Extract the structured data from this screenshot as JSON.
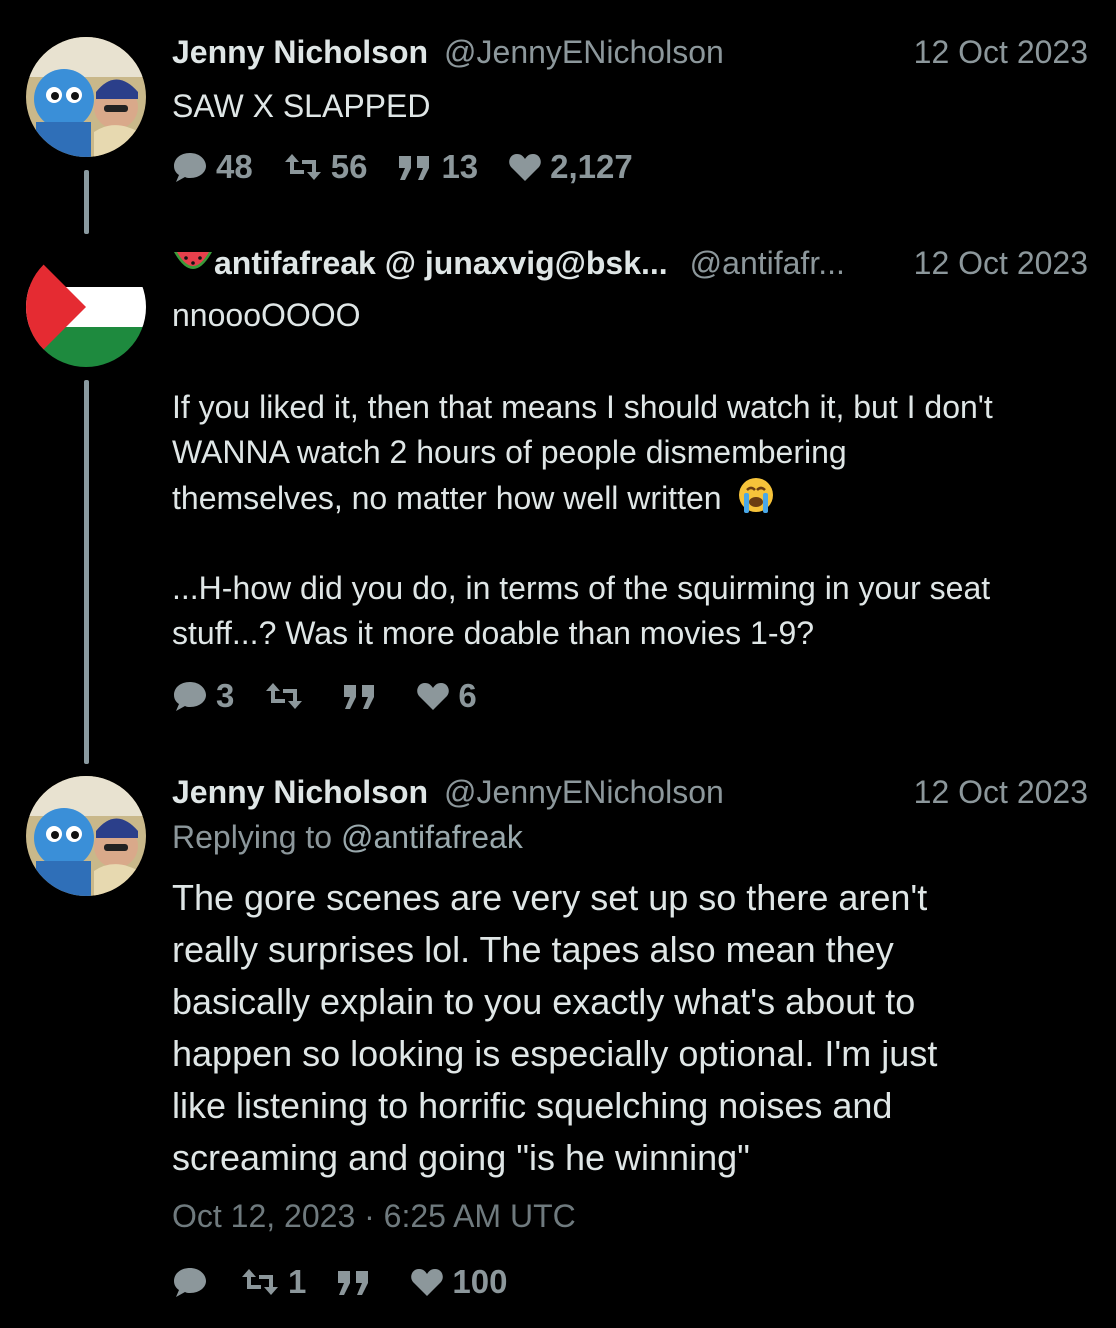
{
  "tweets": [
    {
      "name": "Jenny Nicholson",
      "handle": "@JennyENicholson",
      "date": "12 Oct 2023",
      "text": [
        "SAW X SLAPPED"
      ],
      "stats": {
        "replies": "48",
        "retweets": "56",
        "quotes": "13",
        "likes": "2,127"
      }
    },
    {
      "name": "antifafreak @ junaxvig@bsk...",
      "handle": "@antifafr...",
      "date": "12 Oct 2023",
      "text": [
        "nnoooOOOO",
        "",
        "If you liked it, then that means I should watch it, but I don't",
        "WANNA watch 2 hours of people dismembering",
        "themselves, no matter how well written",
        "",
        "...H-how did you do, in terms of the squirming in your seat",
        "stuff...? Was it more doable than movies 1-9?"
      ],
      "stats": {
        "replies": "3",
        "retweets": "",
        "quotes": "",
        "likes": "6"
      }
    },
    {
      "name": "Jenny Nicholson",
      "handle": "@JennyENicholson",
      "date": "12 Oct 2023",
      "replying_prefix": "Replying to",
      "replying_to": "@antifafreak",
      "text": [
        "The gore scenes are very set up so there aren't",
        "really surprises lol. The tapes also mean they",
        "basically explain to you exactly what's about to",
        "happen so looking is especially optional. I'm just",
        "like listening to horrific squelching noises and",
        "screaming and going \"is he winning\""
      ],
      "timestamp": "Oct 12, 2023 · 6:25 AM UTC",
      "stats": {
        "replies": "",
        "retweets": "1",
        "quotes": "",
        "likes": "100"
      }
    }
  ],
  "colors": {
    "background": "#000000",
    "text": "#dfe6e6",
    "muted": "#8c979b",
    "thread_line": "#8a9aa0"
  }
}
